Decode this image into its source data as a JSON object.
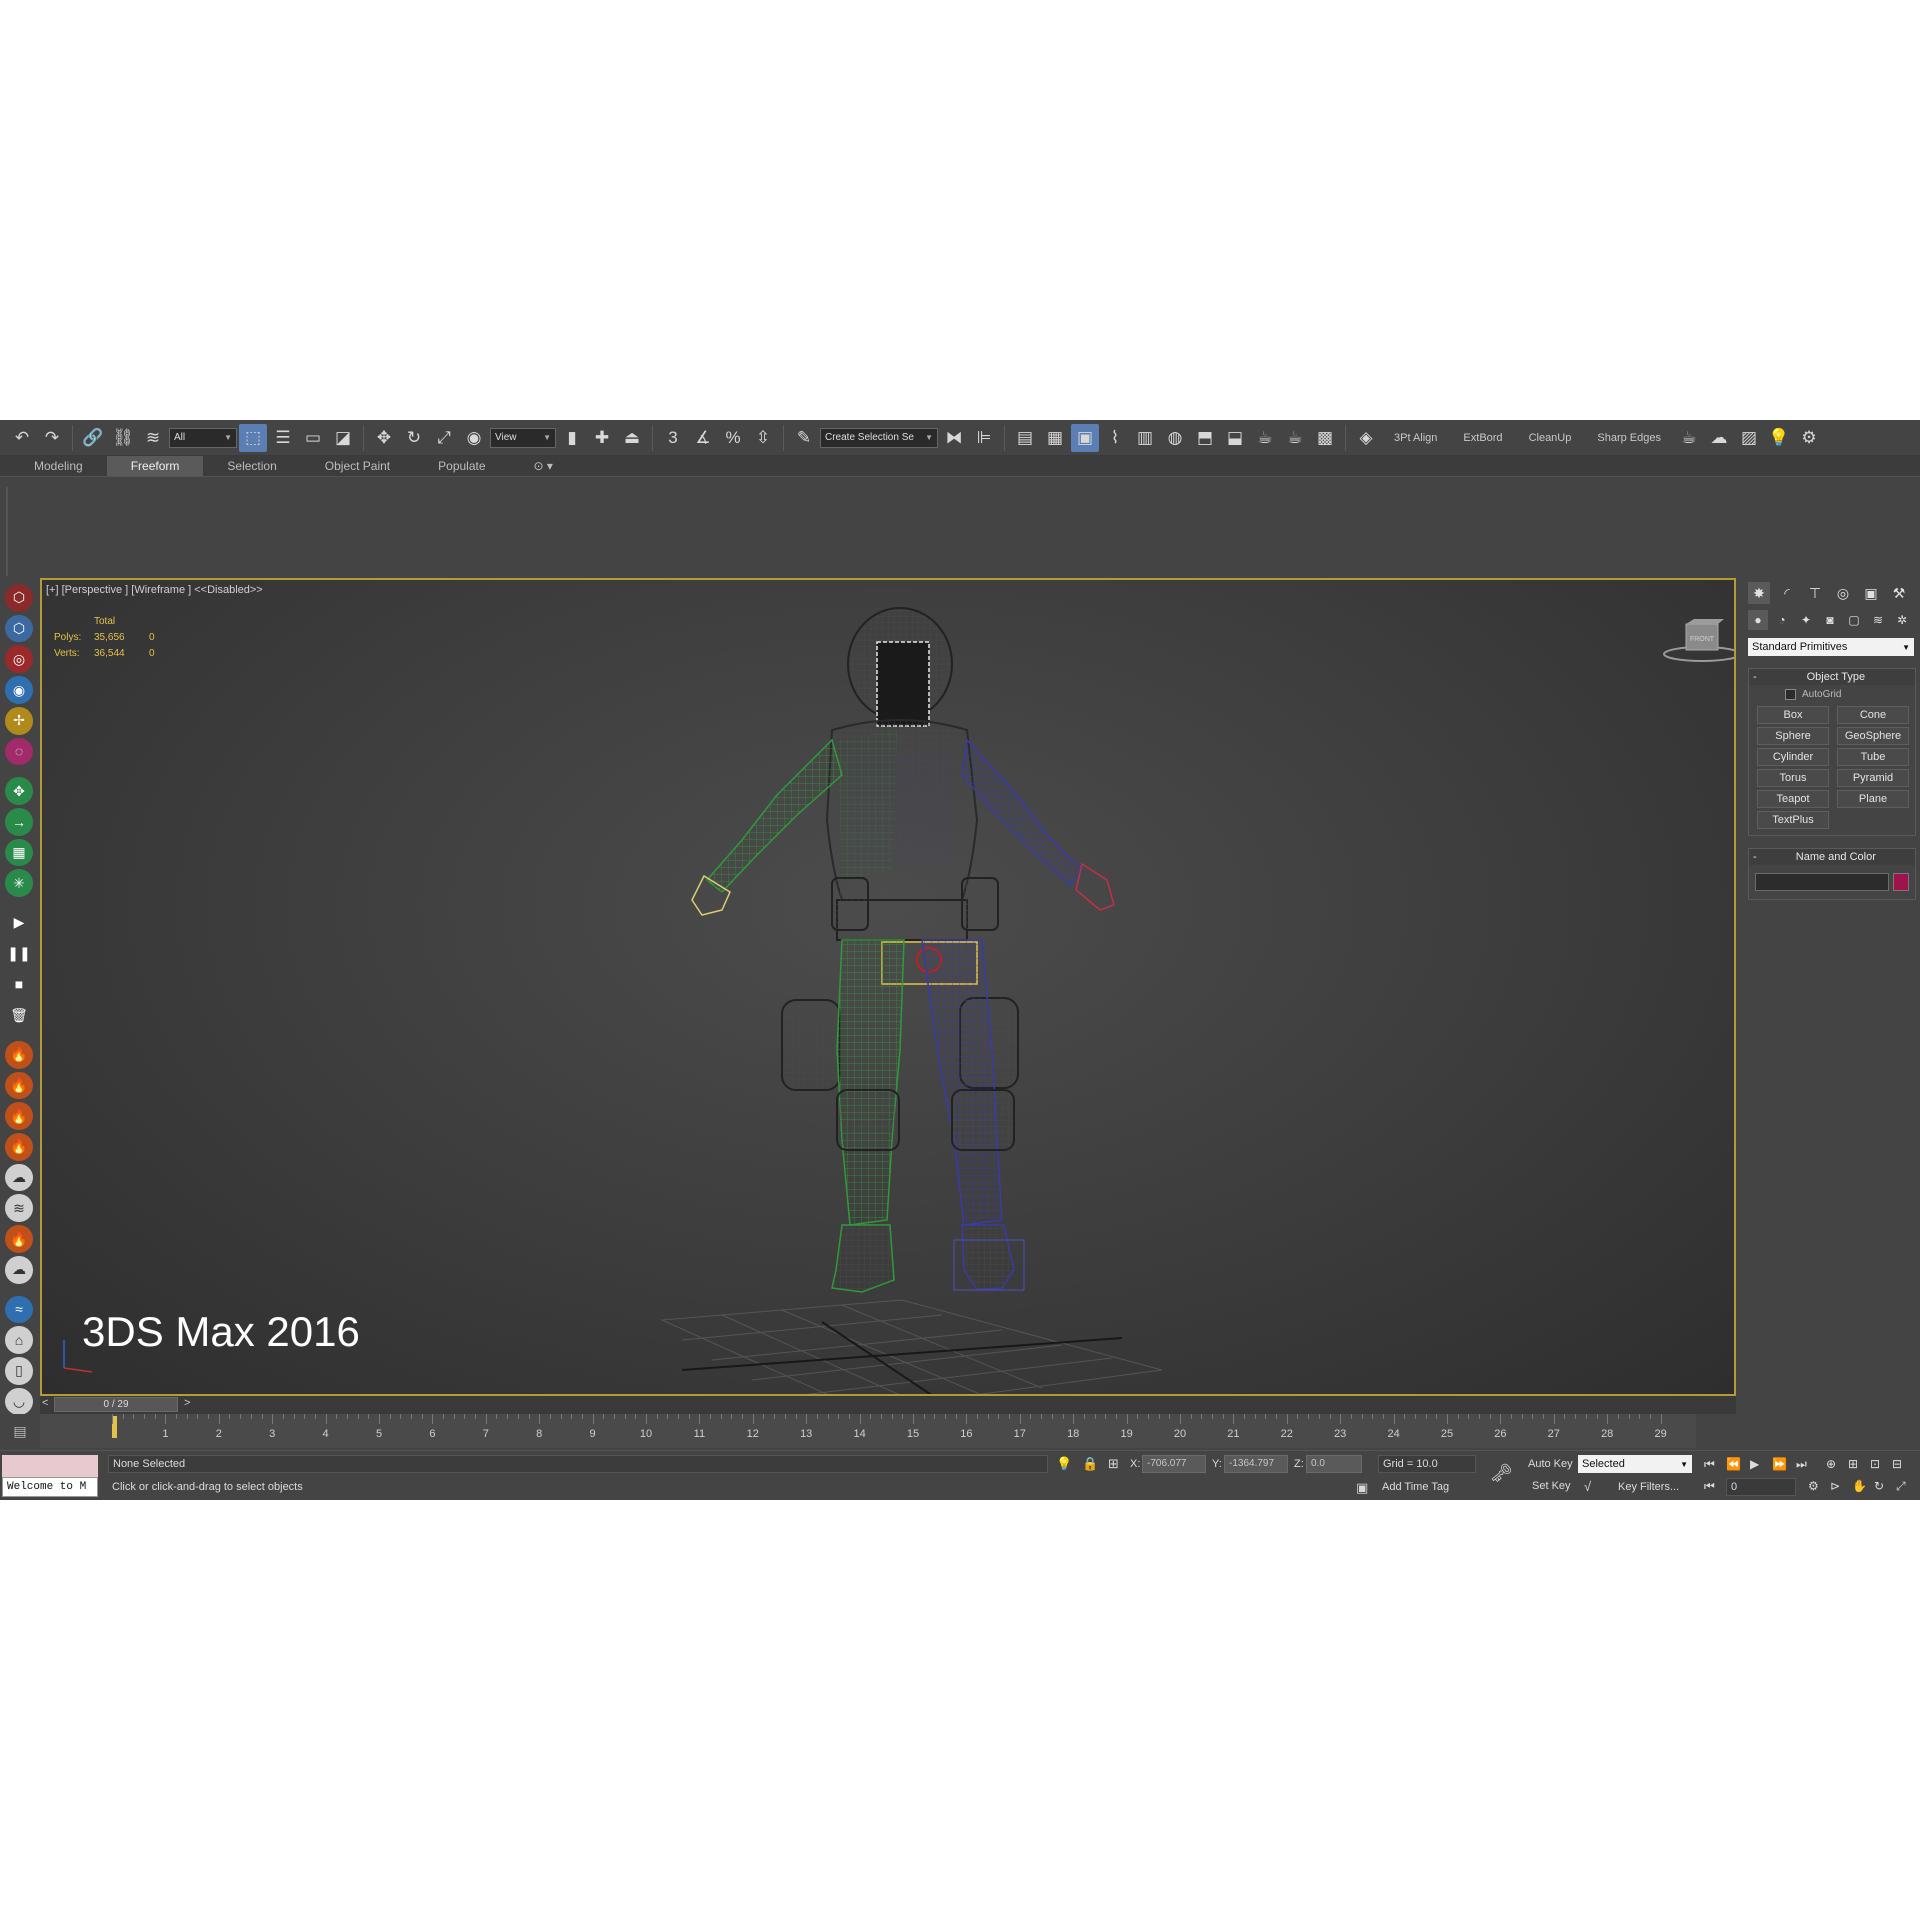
{
  "toolbar": {
    "filter_select": "All",
    "ref_coord_select": "View",
    "named_selection": "Create Selection Se",
    "snap_label": "3",
    "angle_snap_label": "",
    "percent_snap_label": "%",
    "scripts": [
      "3Pt Align",
      "ExtBord",
      "CleanUp",
      "Sharp Edges"
    ]
  },
  "ribbon": {
    "tabs": [
      "Modeling",
      "Freeform",
      "Selection",
      "Object Paint",
      "Populate"
    ],
    "active_tab": "Freeform"
  },
  "viewport": {
    "label": "[+] [Perspective ] [Wireframe ]  <<Disabled>>",
    "stats_header": "Total",
    "polys_label": "Polys:",
    "polys_value": "35,656",
    "polys_sel": "0",
    "verts_label": "Verts:",
    "verts_value": "36,544",
    "verts_sel": "0",
    "watermark": "3DS Max 2016",
    "viewcube_label": "FRONT"
  },
  "command_panel": {
    "dropdown": "Standard Primitives",
    "object_type_title": "Object Type",
    "autogrid_label": "AutoGrid",
    "primitives": [
      "Box",
      "Cone",
      "Sphere",
      "GeoSphere",
      "Cylinder",
      "Tube",
      "Torus",
      "Pyramid",
      "Teapot",
      "Plane",
      "TextPlus"
    ],
    "name_color_title": "Name and Color",
    "swatch_color": "#a0124a"
  },
  "timeline": {
    "slider_label": "0 / 29",
    "left_arrow": "<",
    "right_arrow": ">",
    "frames": [
      "0",
      "1",
      "2",
      "3",
      "4",
      "5",
      "6",
      "7",
      "8",
      "9",
      "10",
      "11",
      "12",
      "13",
      "14",
      "15",
      "16",
      "17",
      "18",
      "19",
      "20",
      "21",
      "22",
      "23",
      "24",
      "25",
      "26",
      "27",
      "28",
      "29"
    ]
  },
  "status": {
    "maxscript_text": "Welcome to M",
    "selection_status": "None Selected",
    "prompt": "Click or click-and-drag to select objects",
    "x_label": "X:",
    "x_value": "-706.077",
    "y_label": "Y:",
    "y_value": "-1364.797",
    "z_label": "Z:",
    "z_value": "0.0",
    "grid": "Grid = 10.0",
    "add_time_tag": "Add Time Tag",
    "auto_key": "Auto Key",
    "set_key": "Set Key",
    "key_mode_select": "Selected",
    "key_filters": "Key Filters...",
    "frame_field": "0"
  }
}
